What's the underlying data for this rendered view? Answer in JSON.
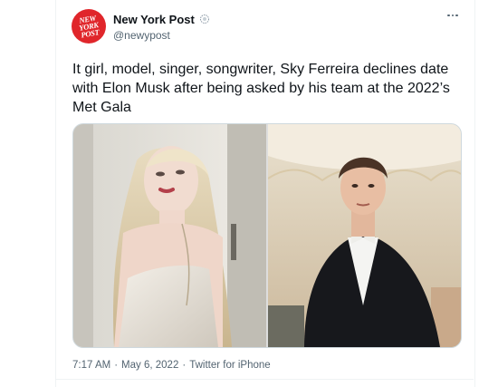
{
  "tweet": {
    "display_name": "New York Post",
    "handle": "@newypost",
    "avatar_logo": [
      "NEW",
      "YORK",
      "POST"
    ],
    "text": "It girl, model, singer, songwriter, Sky Ferreira declines date with Elon Musk after being asked by his team at the 2022’s Met Gala",
    "time": "7:17 AM",
    "separator": "·",
    "date": "May 6, 2022",
    "source": "Twitter for iPhone"
  },
  "icons": {
    "verified": "verified-badge-icon",
    "more": "more-options-icon"
  },
  "colors": {
    "brand_red": "#e0262b",
    "text_primary": "#0f1419",
    "text_secondary": "#536471"
  }
}
